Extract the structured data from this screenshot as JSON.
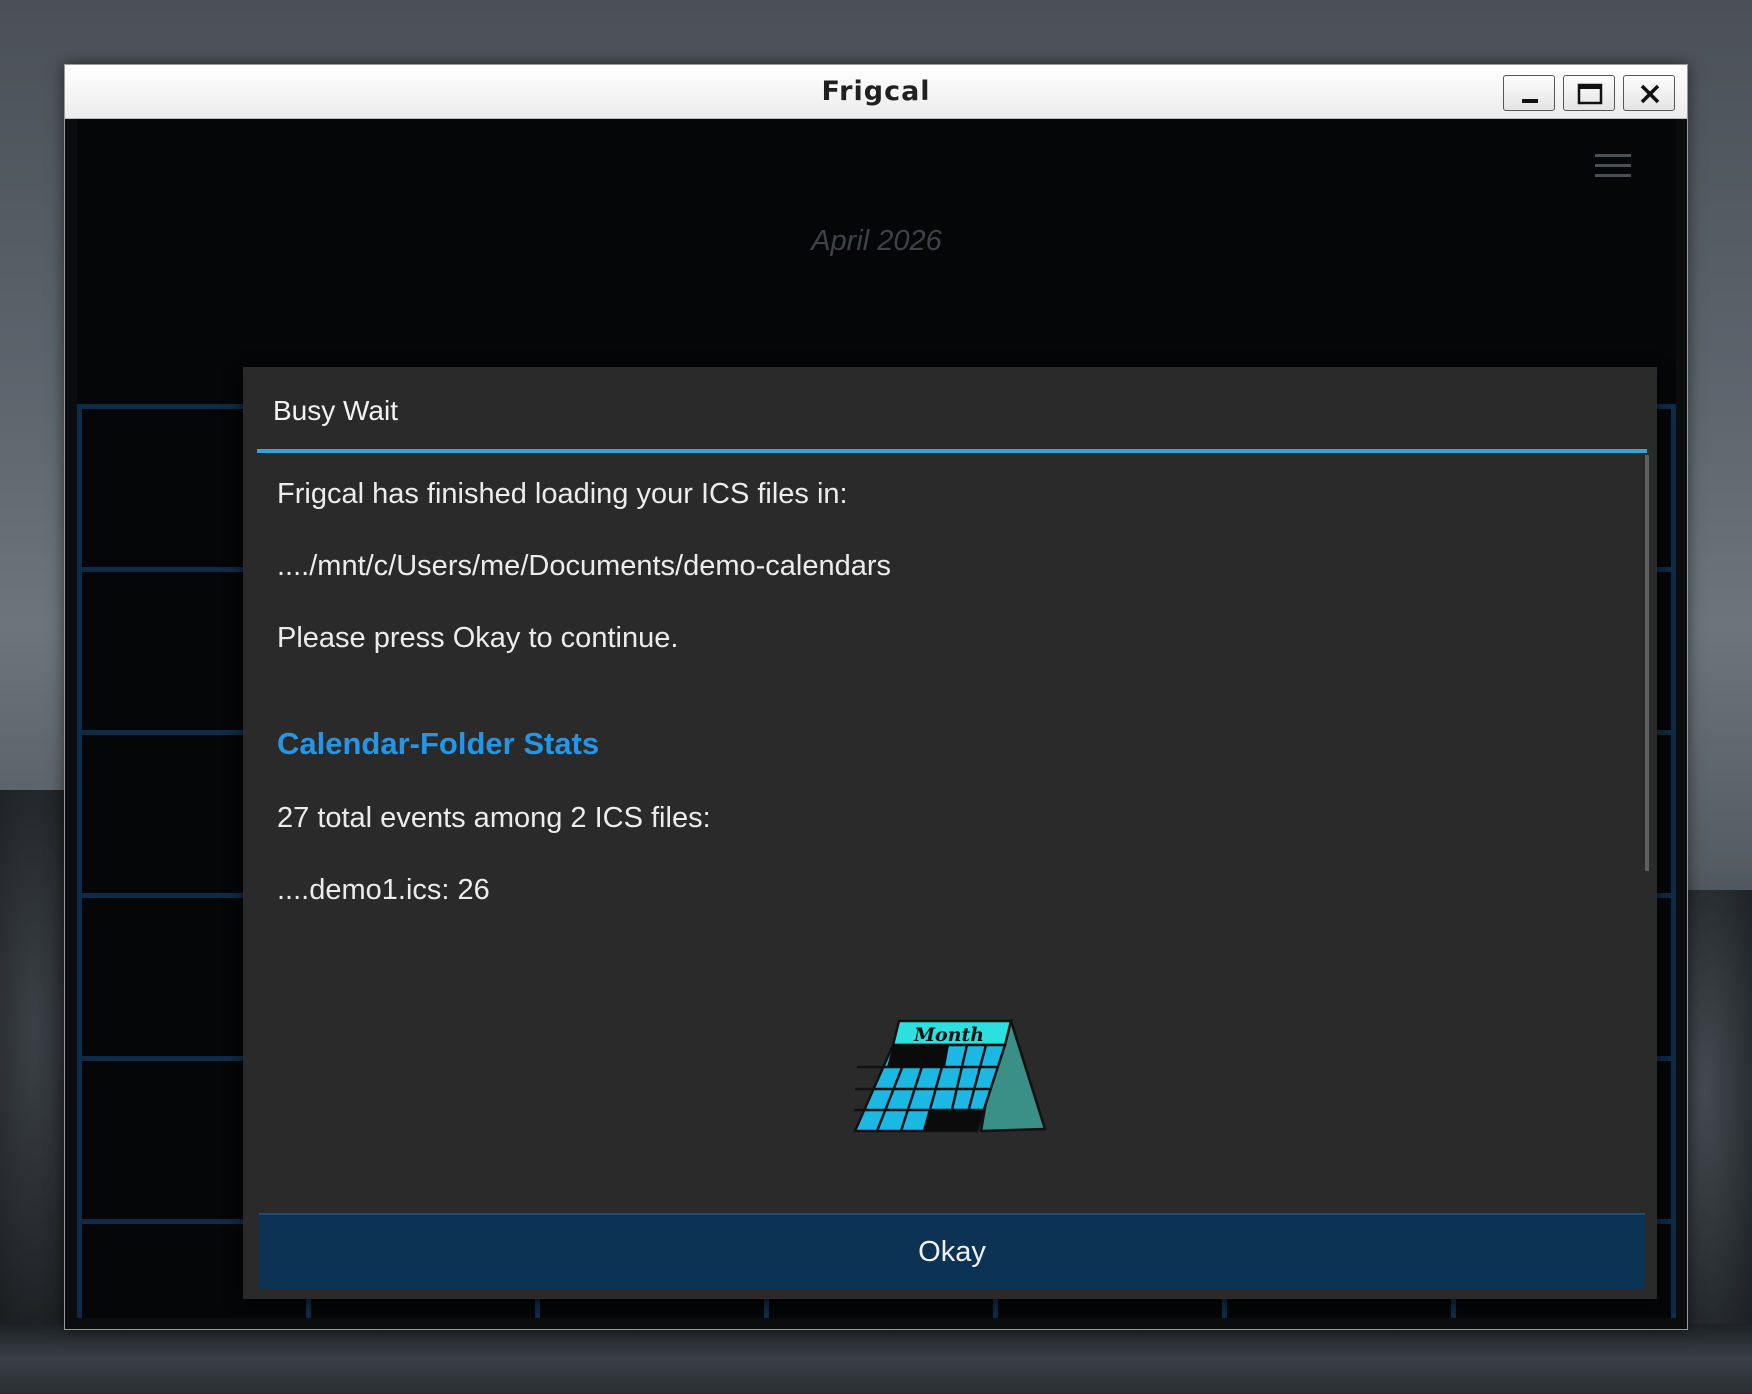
{
  "window": {
    "title": "Frigcal"
  },
  "calendar": {
    "month_label": "April 2026"
  },
  "dialog": {
    "title": "Busy Wait",
    "message_line1": "Frigcal has finished loading your ICS files in:",
    "message_path": "..../mnt/c/Users/me/Documents/demo-calendars",
    "message_line3": "Please press Okay to continue.",
    "stats_heading": "Calendar-Folder Stats",
    "stats_summary": "27 total events among 2 ICS files:",
    "stats_file1": "....demo1.ics: 26",
    "calendar_image_text": "Month",
    "okay_label": "Okay"
  },
  "colors": {
    "accent": "#33a4de",
    "heading": "#2596e6",
    "okay_button_bg": "#0c3354",
    "grid_line": "#0e2b48",
    "dialog_bg": "#2a2a2a"
  },
  "icons": {
    "menu": "hamburger-icon",
    "minimize": "minimize-icon",
    "maximize": "maximize-icon",
    "close": "close-icon"
  }
}
